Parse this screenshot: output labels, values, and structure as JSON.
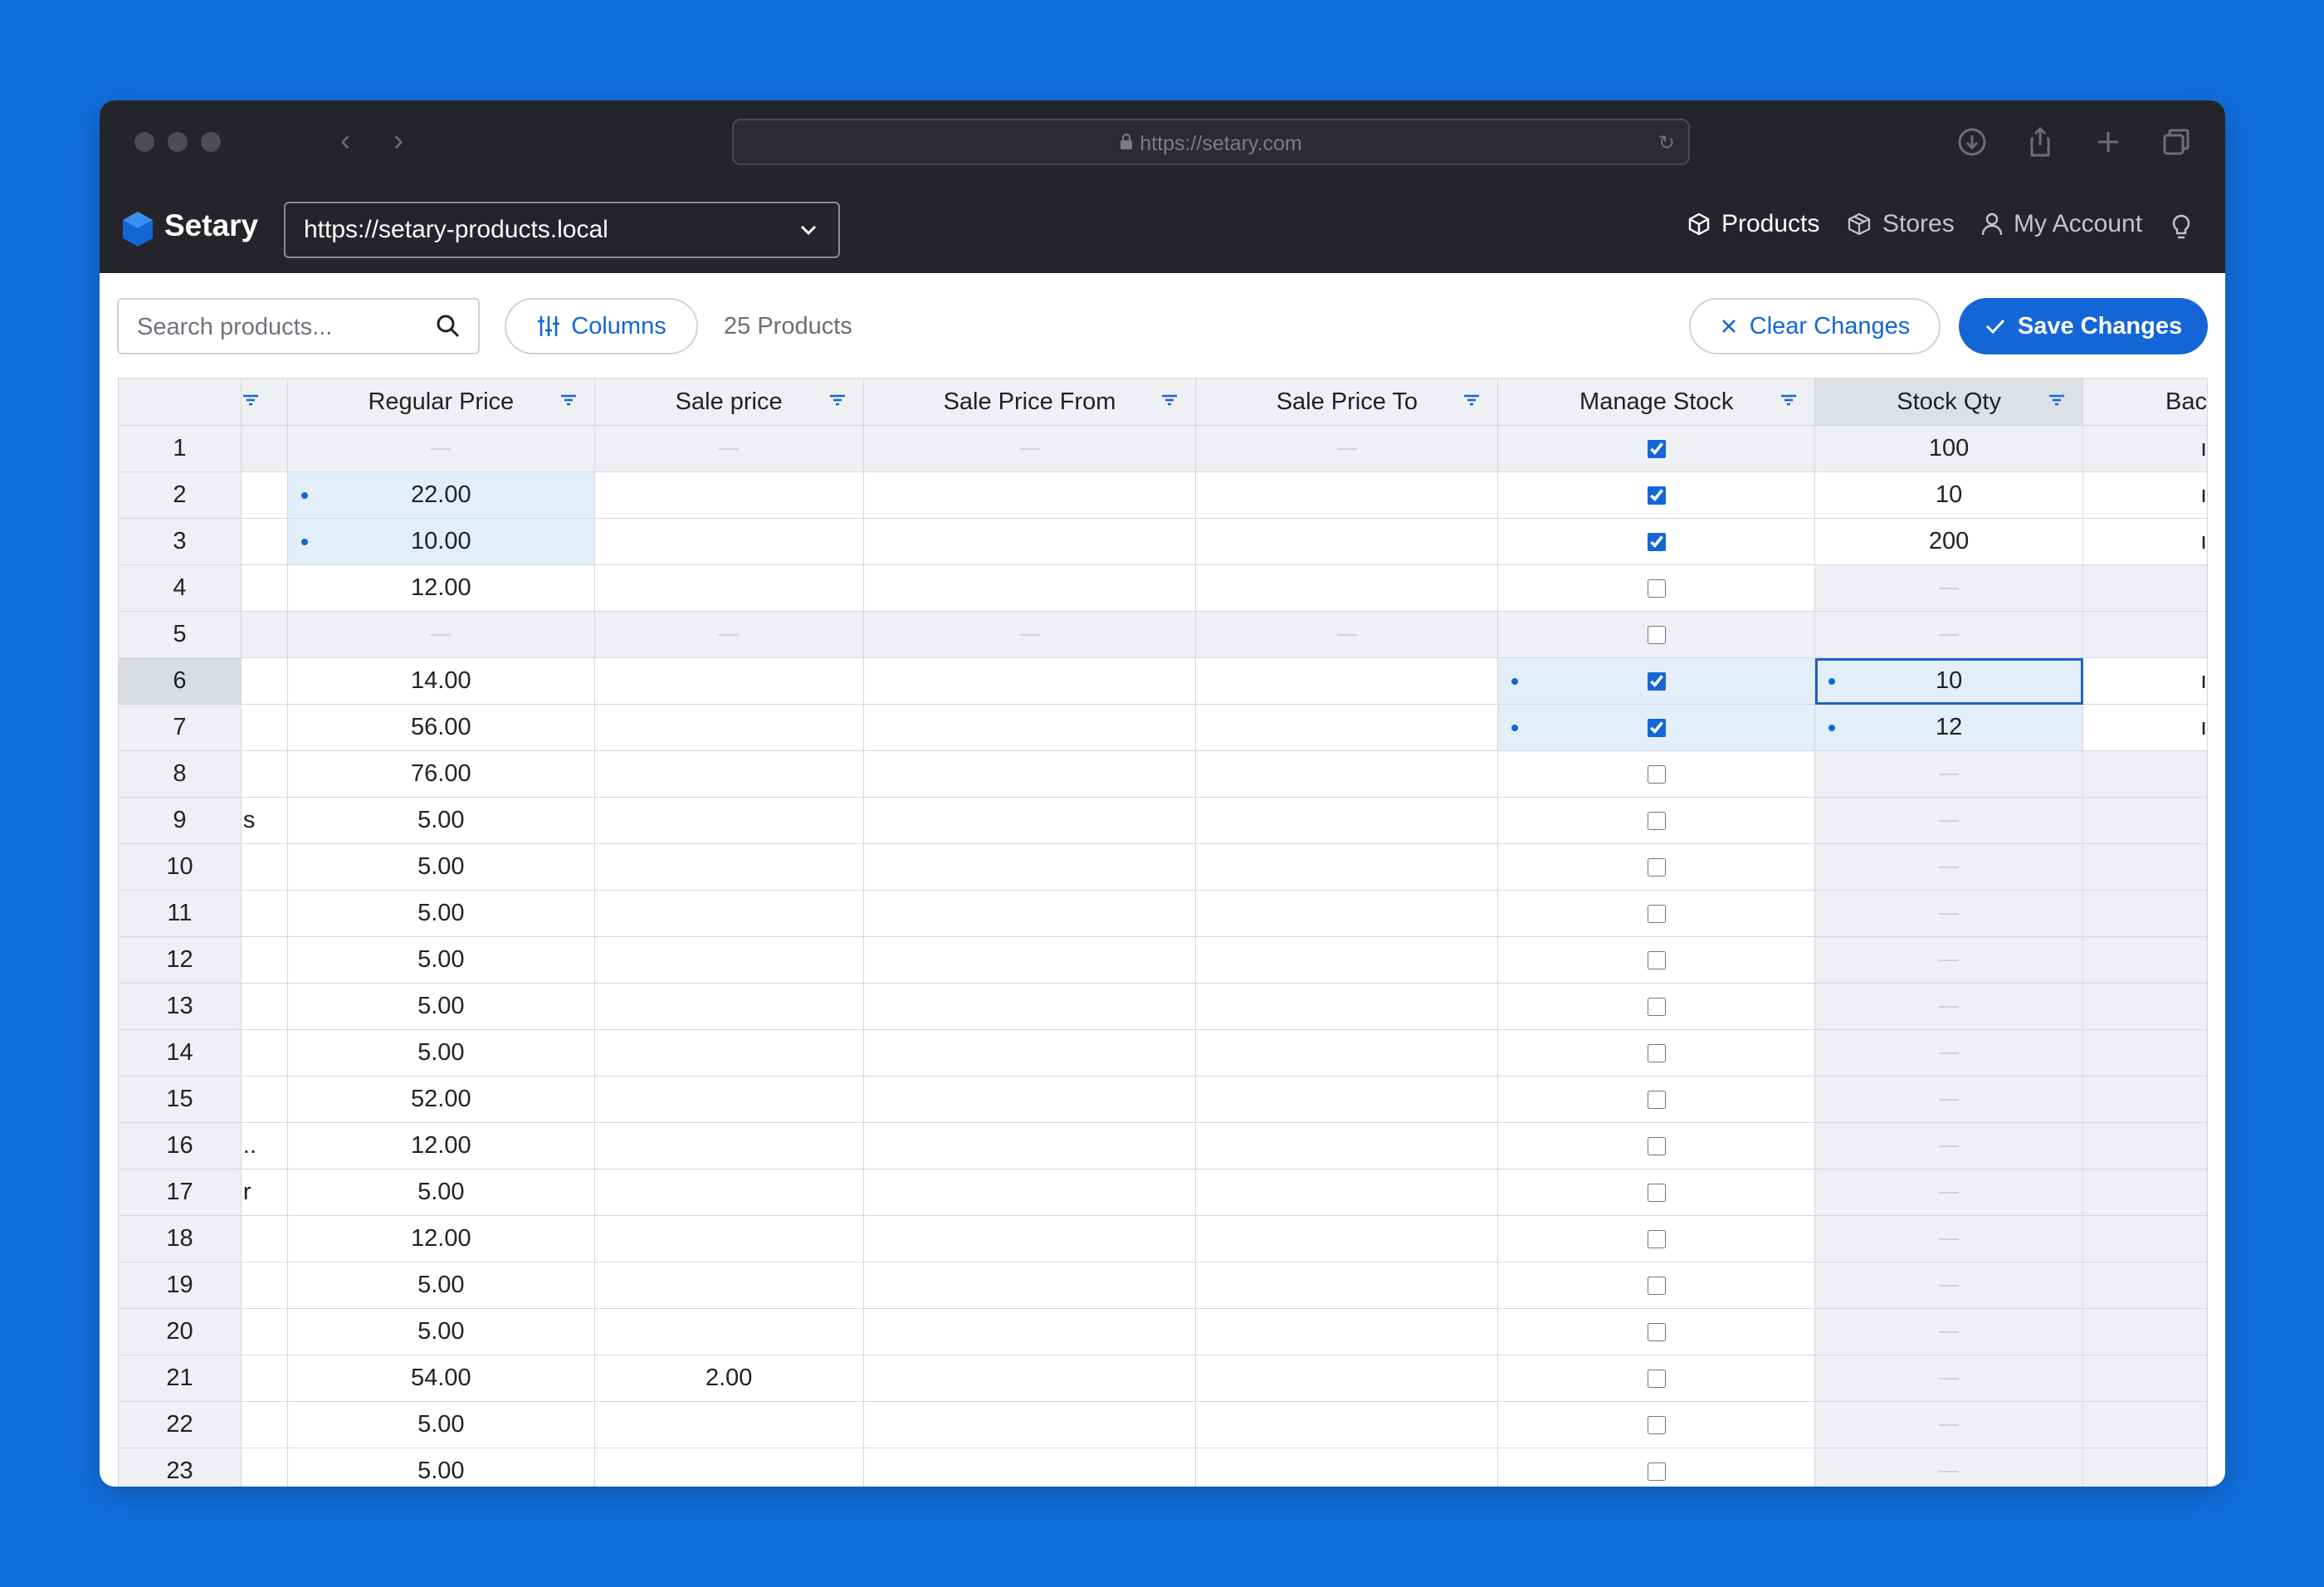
{
  "browser": {
    "url": "https://setary.com"
  },
  "app": {
    "name": "Setary",
    "store_url": "https://setary-products.local",
    "nav": {
      "products": "Products",
      "stores": "Stores",
      "account": "My Account"
    }
  },
  "toolbar": {
    "search_placeholder": "Search products...",
    "columns_label": "Columns",
    "product_count": "25 Products",
    "clear_label": "Clear Changes",
    "save_label": "Save Changes"
  },
  "colors": {
    "background": "#1170e0",
    "header": "#242529",
    "accent": "#1466d6",
    "changed_cell": "#e3eefb"
  },
  "grid": {
    "columns": [
      "Regular Price",
      "Sale price",
      "Sale Price From",
      "Sale Price To",
      "Manage Stock",
      "Stock Qty",
      "Bac"
    ],
    "rows": [
      {
        "n": "1",
        "prefix": "",
        "regular": "",
        "sale": "",
        "manage": true,
        "qty": "100",
        "back": "ı",
        "grey": true
      },
      {
        "n": "2",
        "prefix": "",
        "regular": "22.00",
        "sale": "",
        "manage": true,
        "qty": "10",
        "back": "ı",
        "reg_changed": true
      },
      {
        "n": "3",
        "prefix": "",
        "regular": "10.00",
        "sale": "",
        "manage": true,
        "qty": "200",
        "back": "ı",
        "reg_changed": true
      },
      {
        "n": "4",
        "prefix": "",
        "regular": "12.00",
        "sale": "",
        "manage": false,
        "qty": "",
        "back": ""
      },
      {
        "n": "5",
        "prefix": "",
        "regular": "",
        "sale": "",
        "manage": false,
        "qty": "",
        "back": "",
        "grey": true
      },
      {
        "n": "6",
        "prefix": "",
        "regular": "14.00",
        "sale": "",
        "manage": true,
        "qty": "10",
        "back": "ı",
        "stock_changed": true,
        "selected": true
      },
      {
        "n": "7",
        "prefix": "",
        "regular": "56.00",
        "sale": "",
        "manage": true,
        "qty": "12",
        "back": "ı",
        "stock_changed": true
      },
      {
        "n": "8",
        "prefix": "",
        "regular": "76.00",
        "sale": "",
        "manage": false,
        "qty": "",
        "back": ""
      },
      {
        "n": "9",
        "prefix": "s",
        "regular": "5.00",
        "sale": "",
        "manage": false,
        "qty": "",
        "back": ""
      },
      {
        "n": "10",
        "prefix": "",
        "regular": "5.00",
        "sale": "",
        "manage": false,
        "qty": "",
        "back": ""
      },
      {
        "n": "11",
        "prefix": "",
        "regular": "5.00",
        "sale": "",
        "manage": false,
        "qty": "",
        "back": ""
      },
      {
        "n": "12",
        "prefix": "",
        "regular": "5.00",
        "sale": "",
        "manage": false,
        "qty": "",
        "back": ""
      },
      {
        "n": "13",
        "prefix": "",
        "regular": "5.00",
        "sale": "",
        "manage": false,
        "qty": "",
        "back": ""
      },
      {
        "n": "14",
        "prefix": "",
        "regular": "5.00",
        "sale": "",
        "manage": false,
        "qty": "",
        "back": ""
      },
      {
        "n": "15",
        "prefix": "",
        "regular": "52.00",
        "sale": "",
        "manage": false,
        "qty": "",
        "back": ""
      },
      {
        "n": "16",
        "prefix": "..",
        "regular": "12.00",
        "sale": "",
        "manage": false,
        "qty": "",
        "back": ""
      },
      {
        "n": "17",
        "prefix": "r",
        "regular": "5.00",
        "sale": "",
        "manage": false,
        "qty": "",
        "back": ""
      },
      {
        "n": "18",
        "prefix": "",
        "regular": "12.00",
        "sale": "",
        "manage": false,
        "qty": "",
        "back": ""
      },
      {
        "n": "19",
        "prefix": "",
        "regular": "5.00",
        "sale": "",
        "manage": false,
        "qty": "",
        "back": ""
      },
      {
        "n": "20",
        "prefix": "",
        "regular": "5.00",
        "sale": "",
        "manage": false,
        "qty": "",
        "back": ""
      },
      {
        "n": "21",
        "prefix": "",
        "regular": "54.00",
        "sale": "2.00",
        "manage": false,
        "qty": "",
        "back": ""
      },
      {
        "n": "22",
        "prefix": "",
        "regular": "5.00",
        "sale": "",
        "manage": false,
        "qty": "",
        "back": ""
      },
      {
        "n": "23",
        "prefix": "",
        "regular": "5.00",
        "sale": "",
        "manage": false,
        "qty": "",
        "back": ""
      }
    ]
  }
}
